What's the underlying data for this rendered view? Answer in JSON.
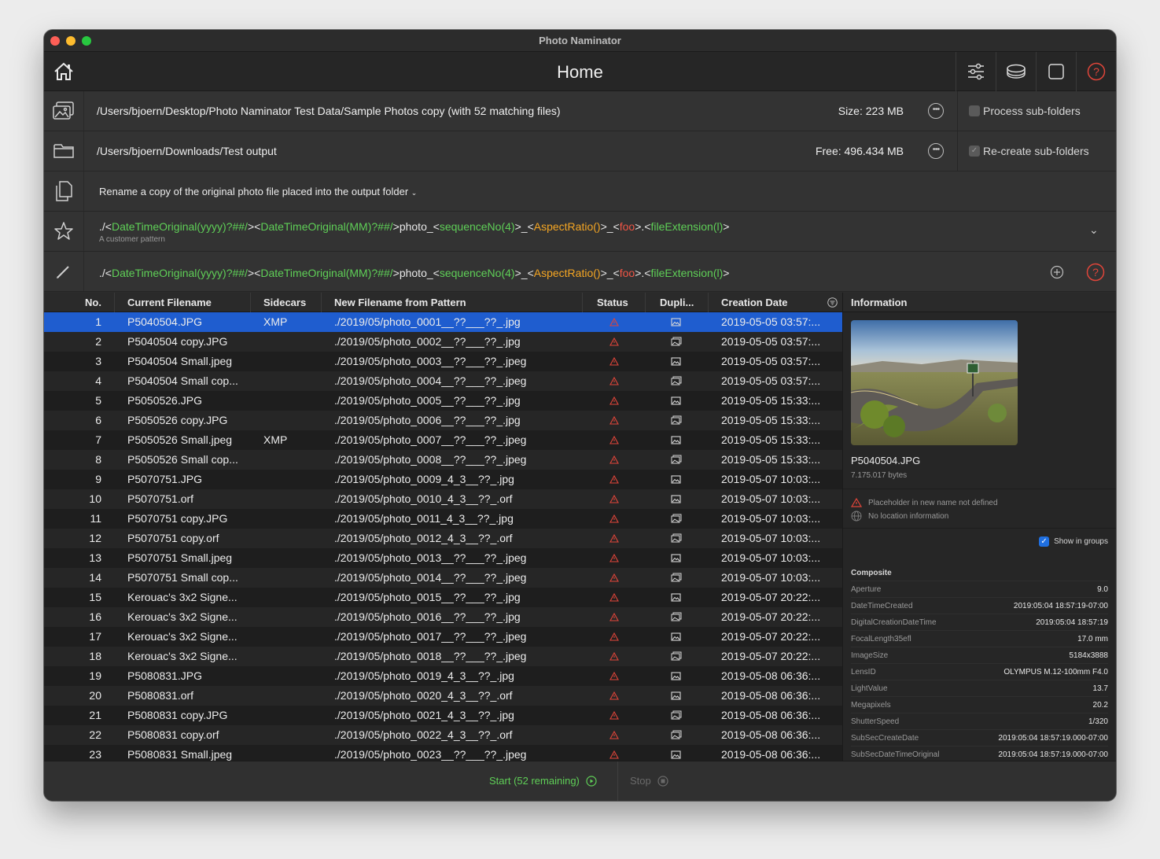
{
  "window": {
    "title": "Photo Naminator"
  },
  "toolbar": {
    "page_title": "Home"
  },
  "source": {
    "path": "/Users/bjoern/Desktop/Photo Naminator Test Data/Sample Photos copy (with 52 matching files)",
    "size": "Size: 223 MB",
    "subfolders_label": "Process sub-folders",
    "subfolders_checked": false
  },
  "output": {
    "path": "/Users/bjoern/Downloads/Test output",
    "free": "Free: 496.434 MB",
    "subfolders_label": "Re-create sub-folders",
    "subfolders_checked": true
  },
  "mode": {
    "label": "Rename a copy of the original photo file placed into the output folder"
  },
  "pattern_preset": {
    "tokens": [
      {
        "text": "./",
        "color": "white"
      },
      {
        "text": "<",
        "color": "white"
      },
      {
        "text": "DateTimeOriginal(yyyy)?##/",
        "color": "green"
      },
      {
        "text": ">",
        "color": "white"
      },
      {
        "text": "<",
        "color": "white"
      },
      {
        "text": "DateTimeOriginal(MM)?##/",
        "color": "green"
      },
      {
        "text": ">",
        "color": "white"
      },
      {
        "text": "photo_",
        "color": "white"
      },
      {
        "text": "<",
        "color": "white"
      },
      {
        "text": "sequenceNo(4)",
        "color": "green"
      },
      {
        "text": ">",
        "color": "white"
      },
      {
        "text": "_",
        "color": "white"
      },
      {
        "text": "<",
        "color": "white"
      },
      {
        "text": "AspectRatio()",
        "color": "orange"
      },
      {
        "text": ">",
        "color": "white"
      },
      {
        "text": "_",
        "color": "white"
      },
      {
        "text": "<",
        "color": "white"
      },
      {
        "text": "foo",
        "color": "red"
      },
      {
        "text": ">",
        "color": "white"
      },
      {
        "text": ".",
        "color": "white"
      },
      {
        "text": "<",
        "color": "white"
      },
      {
        "text": "fileExtension(l)",
        "color": "green"
      },
      {
        "text": ">",
        "color": "white"
      }
    ],
    "subtitle": "A customer pattern"
  },
  "pattern_edit": {
    "tokens": [
      {
        "text": "./",
        "color": "white"
      },
      {
        "text": "<",
        "color": "white"
      },
      {
        "text": "DateTimeOriginal(yyyy)?##/",
        "color": "green"
      },
      {
        "text": ">",
        "color": "white"
      },
      {
        "text": "<",
        "color": "white"
      },
      {
        "text": "DateTimeOriginal(MM)?##/",
        "color": "green"
      },
      {
        "text": ">",
        "color": "white"
      },
      {
        "text": "photo_",
        "color": "white"
      },
      {
        "text": "<",
        "color": "white"
      },
      {
        "text": "sequenceNo(4)",
        "color": "green"
      },
      {
        "text": ">",
        "color": "white"
      },
      {
        "text": "_",
        "color": "white"
      },
      {
        "text": "<",
        "color": "white"
      },
      {
        "text": "AspectRatio()",
        "color": "orange"
      },
      {
        "text": ">",
        "color": "white"
      },
      {
        "text": "_",
        "color": "white"
      },
      {
        "text": "<",
        "color": "white"
      },
      {
        "text": "foo",
        "color": "red"
      },
      {
        "text": ">",
        "color": "white"
      },
      {
        "text": ".",
        "color": "white"
      },
      {
        "text": "<",
        "color": "white"
      },
      {
        "text": "fileExtension(l)",
        "color": "green"
      },
      {
        "text": ">",
        "color": "white"
      }
    ]
  },
  "colors": {
    "accent": "#1f5dcf",
    "green": "#5fcf57",
    "orange": "#f5a623",
    "red": "#f05545",
    "white": "#e8e8e8"
  },
  "table": {
    "columns": [
      "No.",
      "Current Filename",
      "Sidecars",
      "New Filename from Pattern",
      "Status",
      "Dupli...",
      "Creation Date"
    ],
    "rows": [
      {
        "no": "1",
        "current": "P5040504.JPG",
        "sidecars": "XMP",
        "new": "./2019/05/photo_0001__??___??_.jpg",
        "date": "2019-05-05 03:57:...",
        "dup": "single",
        "selected": true
      },
      {
        "no": "2",
        "current": "P5040504 copy.JPG",
        "sidecars": "",
        "new": "./2019/05/photo_0002__??___??_.jpg",
        "date": "2019-05-05 03:57:...",
        "dup": "multi"
      },
      {
        "no": "3",
        "current": "P5040504 Small.jpeg",
        "sidecars": "",
        "new": "./2019/05/photo_0003__??___??_.jpeg",
        "date": "2019-05-05 03:57:...",
        "dup": "single"
      },
      {
        "no": "4",
        "current": "P5040504 Small cop...",
        "sidecars": "",
        "new": "./2019/05/photo_0004__??___??_.jpeg",
        "date": "2019-05-05 03:57:...",
        "dup": "multi"
      },
      {
        "no": "5",
        "current": "P5050526.JPG",
        "sidecars": "",
        "new": "./2019/05/photo_0005__??___??_.jpg",
        "date": "2019-05-05 15:33:...",
        "dup": "single"
      },
      {
        "no": "6",
        "current": "P5050526 copy.JPG",
        "sidecars": "",
        "new": "./2019/05/photo_0006__??___??_.jpg",
        "date": "2019-05-05 15:33:...",
        "dup": "multi"
      },
      {
        "no": "7",
        "current": "P5050526 Small.jpeg",
        "sidecars": "XMP",
        "new": "./2019/05/photo_0007__??___??_.jpeg",
        "date": "2019-05-05 15:33:...",
        "dup": "single"
      },
      {
        "no": "8",
        "current": "P5050526 Small cop...",
        "sidecars": "",
        "new": "./2019/05/photo_0008__??___??_.jpeg",
        "date": "2019-05-05 15:33:...",
        "dup": "multi"
      },
      {
        "no": "9",
        "current": "P5070751.JPG",
        "sidecars": "",
        "new": "./2019/05/photo_0009_4_3__??_.jpg",
        "date": "2019-05-07 10:03:...",
        "dup": "single"
      },
      {
        "no": "10",
        "current": "P5070751.orf",
        "sidecars": "",
        "new": "./2019/05/photo_0010_4_3__??_.orf",
        "date": "2019-05-07 10:03:...",
        "dup": "single"
      },
      {
        "no": "11",
        "current": "P5070751 copy.JPG",
        "sidecars": "",
        "new": "./2019/05/photo_0011_4_3__??_.jpg",
        "date": "2019-05-07 10:03:...",
        "dup": "multi"
      },
      {
        "no": "12",
        "current": "P5070751 copy.orf",
        "sidecars": "",
        "new": "./2019/05/photo_0012_4_3__??_.orf",
        "date": "2019-05-07 10:03:...",
        "dup": "multi"
      },
      {
        "no": "13",
        "current": "P5070751 Small.jpeg",
        "sidecars": "",
        "new": "./2019/05/photo_0013__??___??_.jpeg",
        "date": "2019-05-07 10:03:...",
        "dup": "single"
      },
      {
        "no": "14",
        "current": "P5070751 Small cop...",
        "sidecars": "",
        "new": "./2019/05/photo_0014__??___??_.jpeg",
        "date": "2019-05-07 10:03:...",
        "dup": "multi"
      },
      {
        "no": "15",
        "current": "Kerouac's 3x2 Signe...",
        "sidecars": "",
        "new": "./2019/05/photo_0015__??___??_.jpg",
        "date": "2019-05-07 20:22:...",
        "dup": "single"
      },
      {
        "no": "16",
        "current": "Kerouac's 3x2 Signe...",
        "sidecars": "",
        "new": "./2019/05/photo_0016__??___??_.jpg",
        "date": "2019-05-07 20:22:...",
        "dup": "multi"
      },
      {
        "no": "17",
        "current": "Kerouac's 3x2 Signe...",
        "sidecars": "",
        "new": "./2019/05/photo_0017__??___??_.jpeg",
        "date": "2019-05-07 20:22:...",
        "dup": "single"
      },
      {
        "no": "18",
        "current": "Kerouac's 3x2 Signe...",
        "sidecars": "",
        "new": "./2019/05/photo_0018__??___??_.jpeg",
        "date": "2019-05-07 20:22:...",
        "dup": "multi"
      },
      {
        "no": "19",
        "current": "P5080831.JPG",
        "sidecars": "",
        "new": "./2019/05/photo_0019_4_3__??_.jpg",
        "date": "2019-05-08 06:36:...",
        "dup": "single"
      },
      {
        "no": "20",
        "current": "P5080831.orf",
        "sidecars": "",
        "new": "./2019/05/photo_0020_4_3__??_.orf",
        "date": "2019-05-08 06:36:...",
        "dup": "single"
      },
      {
        "no": "21",
        "current": "P5080831 copy.JPG",
        "sidecars": "",
        "new": "./2019/05/photo_0021_4_3__??_.jpg",
        "date": "2019-05-08 06:36:...",
        "dup": "multi"
      },
      {
        "no": "22",
        "current": "P5080831 copy.orf",
        "sidecars": "",
        "new": "./2019/05/photo_0022_4_3__??_.orf",
        "date": "2019-05-08 06:36:...",
        "dup": "multi"
      },
      {
        "no": "23",
        "current": "P5080831 Small.jpeg",
        "sidecars": "",
        "new": "./2019/05/photo_0023__??___??_.jpeg",
        "date": "2019-05-08 06:36:...",
        "dup": "single"
      }
    ]
  },
  "info": {
    "header": "Information",
    "filename": "P5040504.JPG",
    "bytes": "7.175.017 bytes",
    "messages": [
      "Placeholder in new name not defined",
      "No location information"
    ],
    "show_in_groups": "Show in groups",
    "composite_title": "Composite",
    "composite": [
      {
        "k": "Aperture",
        "v": "9.0"
      },
      {
        "k": "DateTimeCreated",
        "v": "2019:05:04 18:57:19-07:00"
      },
      {
        "k": "DigitalCreationDateTime",
        "v": "2019:05:04 18:57:19"
      },
      {
        "k": "FocalLength35efl",
        "v": "17.0 mm"
      },
      {
        "k": "ImageSize",
        "v": "5184x3888"
      },
      {
        "k": "LensID",
        "v": "OLYMPUS M.12-100mm F4.0"
      },
      {
        "k": "LightValue",
        "v": "13.7"
      },
      {
        "k": "Megapixels",
        "v": "20.2"
      },
      {
        "k": "ShutterSpeed",
        "v": "1/320"
      },
      {
        "k": "SubSecCreateDate",
        "v": "2019:05:04 18:57:19.000-07:00"
      },
      {
        "k": "SubSecDateTimeOriginal",
        "v": "2019:05:04 18:57:19.000-07:00"
      }
    ]
  },
  "bottom": {
    "start_label": "Start (52 remaining)",
    "stop_label": "Stop"
  }
}
